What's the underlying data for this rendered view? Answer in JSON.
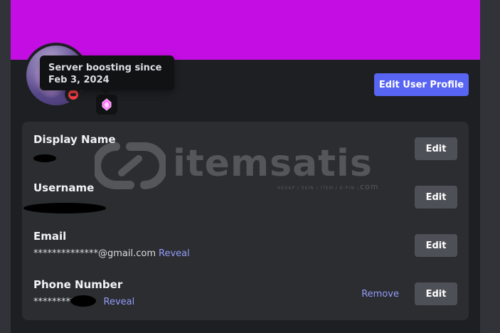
{
  "profile": {
    "banner_color": "#c40de3",
    "status": "do-not-disturb",
    "boost_tooltip": "Server boosting since Feb 3, 2024",
    "edit_profile_label": "Edit User Profile"
  },
  "fields": [
    {
      "label": "Display Name",
      "value": "",
      "edit_label": "Edit"
    },
    {
      "label": "Username",
      "value": "",
      "edit_label": "Edit"
    },
    {
      "label": "Email",
      "value": "**************@gmail.com",
      "reveal_label": "Reveal",
      "edit_label": "Edit"
    },
    {
      "label": "Phone Number",
      "value": "*********",
      "reveal_label": "Reveal",
      "remove_label": "Remove",
      "edit_label": "Edit"
    }
  ],
  "watermark": {
    "brand": "itemsatis",
    "tagline": "HESAP / SKIN / ITEM / E-PIN",
    "domain": ".com"
  },
  "colors": {
    "accent": "#5865f2",
    "link": "#949cf7",
    "dnd": "#f23f43"
  }
}
